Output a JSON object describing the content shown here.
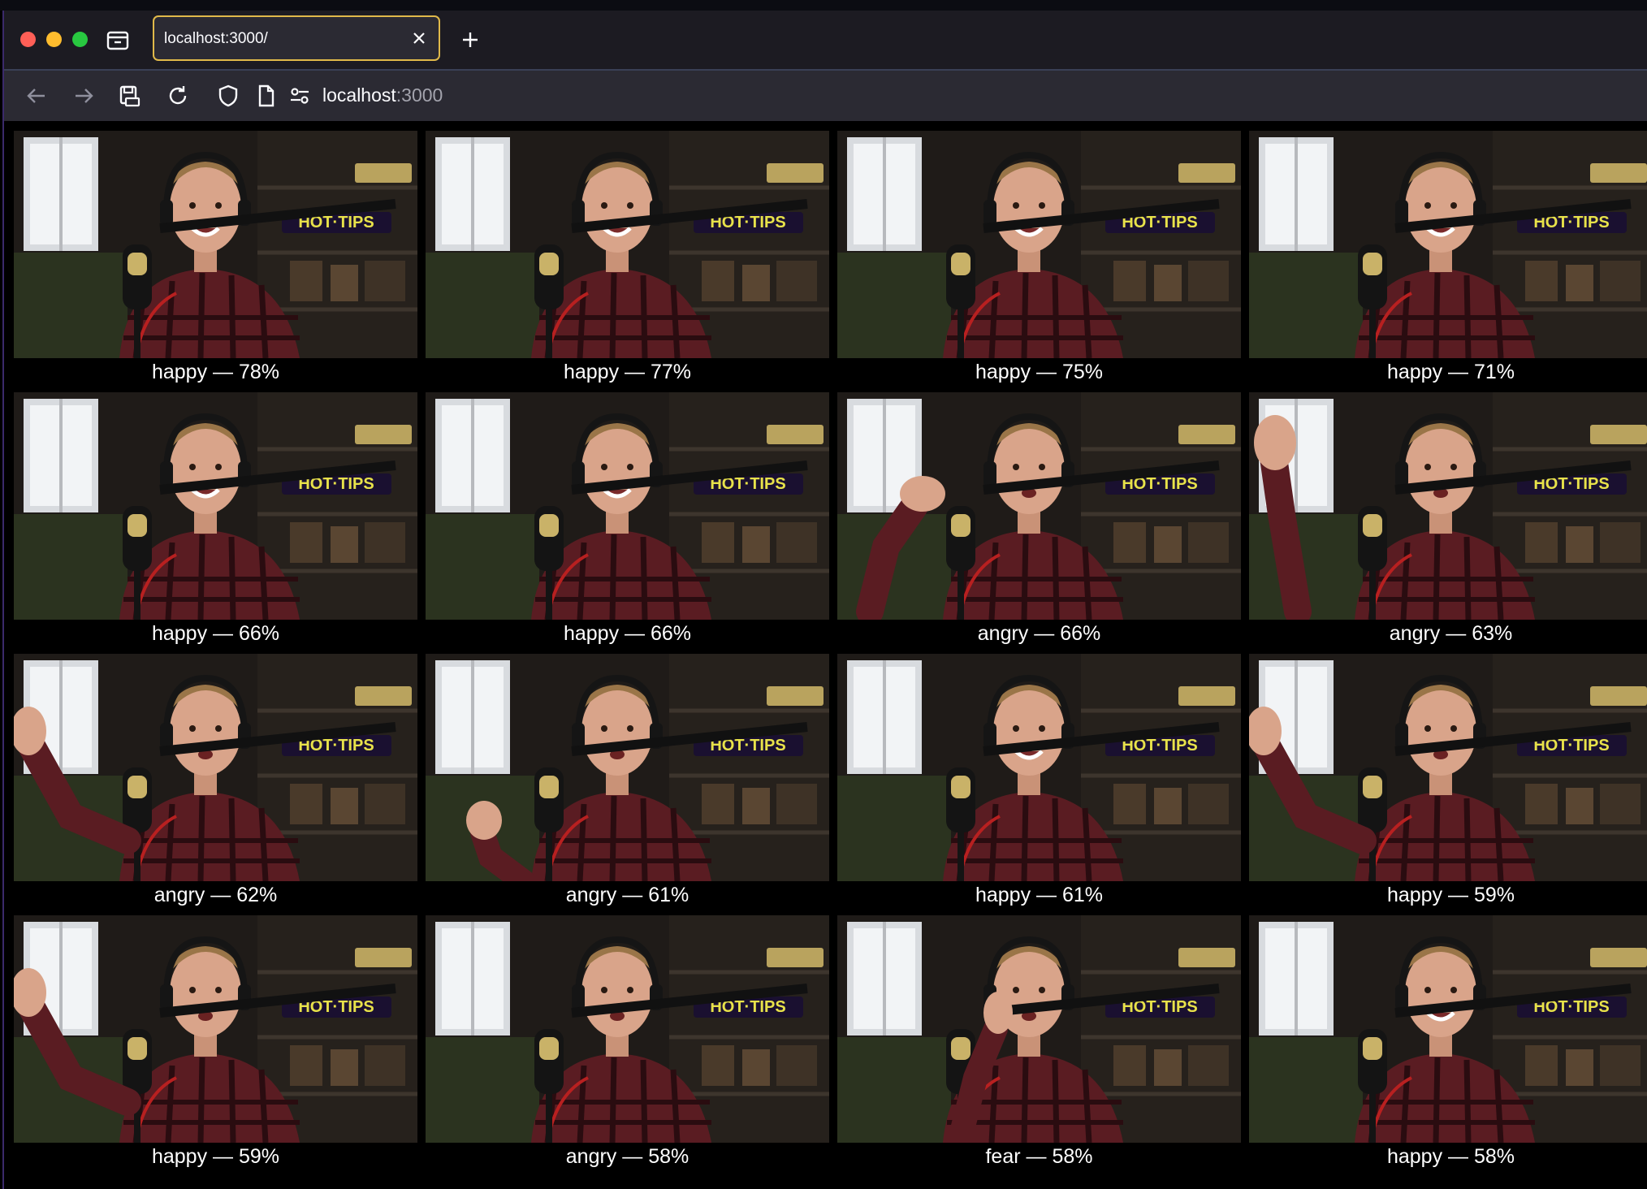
{
  "browser": {
    "tab_title": "localhost:3000/",
    "url_host": "localhost",
    "url_port": ":3000"
  },
  "results": [
    {
      "label": "happy — 78%",
      "pose": "smile"
    },
    {
      "label": "happy — 77%",
      "pose": "smile"
    },
    {
      "label": "happy — 75%",
      "pose": "smile"
    },
    {
      "label": "happy — 71%",
      "pose": "smile"
    },
    {
      "label": "happy — 66%",
      "pose": "smile"
    },
    {
      "label": "happy — 66%",
      "pose": "smile"
    },
    {
      "label": "angry — 66%",
      "pose": "hand-left"
    },
    {
      "label": "angry — 63%",
      "pose": "wave"
    },
    {
      "label": "angry — 62%",
      "pose": "arm-out"
    },
    {
      "label": "angry — 61%",
      "pose": "fist"
    },
    {
      "label": "happy — 61%",
      "pose": "smile"
    },
    {
      "label": "happy — 59%",
      "pose": "arm-out"
    },
    {
      "label": "happy — 59%",
      "pose": "arm-out"
    },
    {
      "label": "angry — 58%",
      "pose": "neutral"
    },
    {
      "label": "fear — 58%",
      "pose": "face-hand"
    },
    {
      "label": "happy — 58%",
      "pose": "smile"
    }
  ],
  "colors": {
    "tab_border": "#e0b94a",
    "tab_bg": "#2b2a33",
    "toolbar_bg": "#2b2a33",
    "caption_text": "#ffffff",
    "page_bg": "#000000",
    "sign": "#e8e24a"
  }
}
